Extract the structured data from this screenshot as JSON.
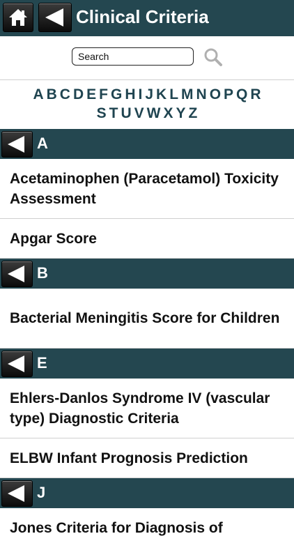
{
  "header": {
    "title": "Clinical Criteria"
  },
  "search": {
    "placeholder": "Search"
  },
  "alphabet": {
    "line1": [
      "A",
      "B",
      "C",
      "D",
      "E",
      "F",
      "G",
      "H",
      "I",
      "J",
      "K",
      "L",
      "M",
      "N",
      "O",
      "P",
      "Q",
      "R"
    ],
    "line2": [
      "S",
      "T",
      "U",
      "V",
      "W",
      "X",
      "Y",
      "Z"
    ]
  },
  "sections": [
    {
      "letter": "A",
      "items": [
        "Acetaminophen (Paracetamol) Toxicity Assessment",
        "Apgar Score"
      ]
    },
    {
      "letter": "B",
      "items": [
        "Bacterial Meningitis Score for Children"
      ]
    },
    {
      "letter": "E",
      "items": [
        "Ehlers-Danlos Syndrome IV (vascular type) Diagnostic Criteria",
        "ELBW Infant Prognosis Prediction"
      ]
    },
    {
      "letter": "J",
      "items": [
        "Jones Criteria for Diagnosis of"
      ]
    }
  ],
  "colors": {
    "header_bg": "#244750",
    "letter_index": "#1f4450"
  }
}
